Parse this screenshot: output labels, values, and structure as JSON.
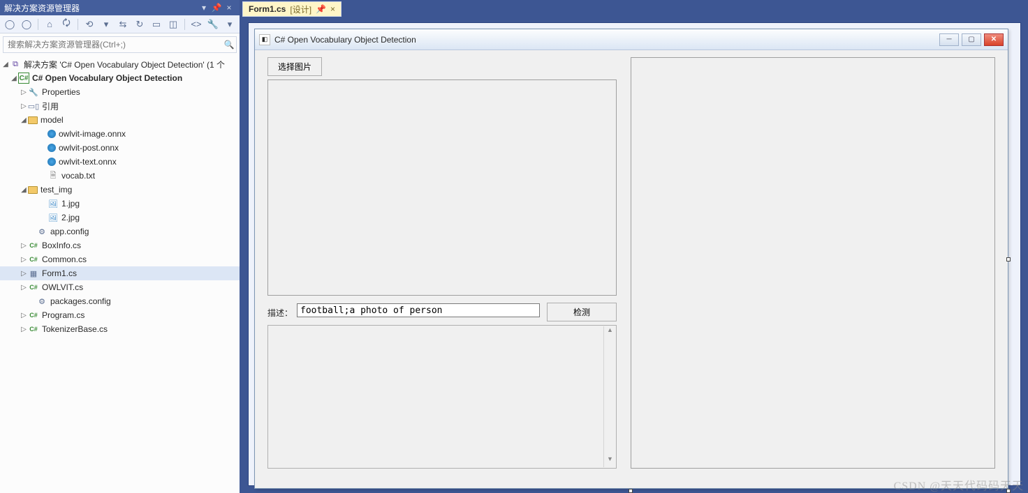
{
  "sidebar": {
    "title": "解决方案资源管理器",
    "search_placeholder": "搜索解决方案资源管理器(Ctrl+;)",
    "solution_label": "解决方案 'C# Open Vocabulary Object Detection' (1 个",
    "project_label": "C# Open Vocabulary Object Detection",
    "properties": "Properties",
    "references": "引用",
    "model_folder": "model",
    "model_files": [
      "owlvit-image.onnx",
      "owlvit-post.onnx",
      "owlvit-text.onnx",
      "vocab.txt"
    ],
    "testimg_folder": "test_img",
    "testimg_files": [
      "1.jpg",
      "2.jpg"
    ],
    "files": [
      "app.config",
      "BoxInfo.cs",
      "Common.cs",
      "Form1.cs",
      "OWLVIT.cs",
      "packages.config",
      "Program.cs",
      "TokenizerBase.cs"
    ]
  },
  "tab": {
    "name": "Form1.cs",
    "suffix": "[设计]"
  },
  "form": {
    "title": "C# Open Vocabulary Object Detection",
    "select_button": "选择图片",
    "desc_label": "描述：",
    "desc_value": "football;a photo of person",
    "detect_button": "检测"
  },
  "watermark": "CSDN @天天代码码天天"
}
